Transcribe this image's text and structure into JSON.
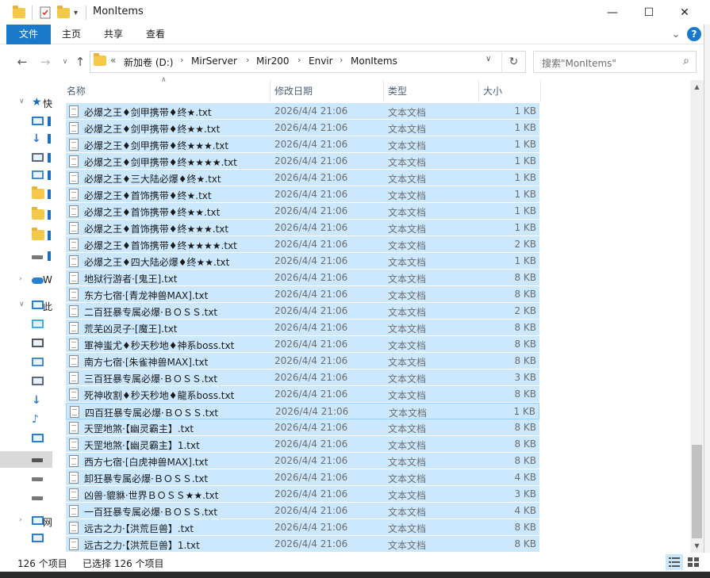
{
  "window": {
    "title": "MonItems",
    "minimize_glyph": "—",
    "maximize_glyph": "☐",
    "close_glyph": "✕"
  },
  "ribbon": {
    "tabs": [
      "文件",
      "主页",
      "共享",
      "查看"
    ],
    "help_glyph": "?",
    "expand_glyph": "⌄"
  },
  "address": {
    "overflow": "«",
    "crumbs": [
      "新加卷 (D:)",
      "MirServer",
      "Mir200",
      "Envir",
      "MonItems"
    ],
    "search_placeholder": "搜索\"MonItems\""
  },
  "navpane": {
    "items": [
      {
        "label": "快",
        "icon": "star-icon"
      },
      {
        "label": "",
        "icon": "desktop-icon"
      },
      {
        "label": "",
        "icon": "download-icon"
      },
      {
        "label": "",
        "icon": "documents-icon"
      },
      {
        "label": "",
        "icon": "pictures-icon"
      },
      {
        "label": "",
        "icon": "folder-icon"
      },
      {
        "label": "",
        "icon": "folder-icon"
      },
      {
        "label": "",
        "icon": "folder-icon"
      },
      {
        "label": "",
        "icon": "drive-icon"
      },
      {
        "label": "W",
        "icon": "cloud-icon"
      },
      {
        "label": "此",
        "icon": "computer-icon"
      },
      {
        "label": "",
        "icon": "3d-objects-icon"
      },
      {
        "label": "",
        "icon": "video-icon"
      },
      {
        "label": "",
        "icon": "pictures-icon"
      },
      {
        "label": "",
        "icon": "documents-icon"
      },
      {
        "label": "",
        "icon": "download-icon"
      },
      {
        "label": "",
        "icon": "music-icon"
      },
      {
        "label": "",
        "icon": "desktop-icon"
      },
      {
        "label": "",
        "icon": "system-drive-icon"
      },
      {
        "label": "",
        "icon": "drive-icon"
      },
      {
        "label": "",
        "icon": "drive-icon"
      },
      {
        "label": "网",
        "icon": "network-icon"
      },
      {
        "label": "",
        "icon": "computer-icon"
      }
    ]
  },
  "columns": {
    "name": "名称",
    "date": "修改日期",
    "type": "类型",
    "size": "大小"
  },
  "files": [
    {
      "name": "必爆之王♦剑甲携带♦终★.txt",
      "date": "2026/4/4 21:06",
      "type": "文本文档",
      "size": "1 KB"
    },
    {
      "name": "必爆之王♦剑甲携带♦终★★.txt",
      "date": "2026/4/4 21:06",
      "type": "文本文档",
      "size": "1 KB"
    },
    {
      "name": "必爆之王♦剑甲携带♦终★★★.txt",
      "date": "2026/4/4 21:06",
      "type": "文本文档",
      "size": "1 KB"
    },
    {
      "name": "必爆之王♦剑甲携带♦终★★★★.txt",
      "date": "2026/4/4 21:06",
      "type": "文本文档",
      "size": "1 KB"
    },
    {
      "name": "必爆之王♦三大陆必爆♦终★.txt",
      "date": "2026/4/4 21:06",
      "type": "文本文档",
      "size": "1 KB"
    },
    {
      "name": "必爆之王♦首饰携带♦终★.txt",
      "date": "2026/4/4 21:06",
      "type": "文本文档",
      "size": "1 KB"
    },
    {
      "name": "必爆之王♦首饰携带♦终★★.txt",
      "date": "2026/4/4 21:06",
      "type": "文本文档",
      "size": "1 KB"
    },
    {
      "name": "必爆之王♦首饰携带♦终★★★.txt",
      "date": "2026/4/4 21:06",
      "type": "文本文档",
      "size": "1 KB"
    },
    {
      "name": "必爆之王♦首饰携带♦终★★★★.txt",
      "date": "2026/4/4 21:06",
      "type": "文本文档",
      "size": "2 KB"
    },
    {
      "name": "必爆之王♦四大陆必爆♦终★★.txt",
      "date": "2026/4/4 21:06",
      "type": "文本文档",
      "size": "1 KB"
    },
    {
      "name": "地狱行游者·[鬼王].txt",
      "date": "2026/4/4 21:06",
      "type": "文本文档",
      "size": "8 KB"
    },
    {
      "name": "东方七宿·[青龙神兽MAX].txt",
      "date": "2026/4/4 21:06",
      "type": "文本文档",
      "size": "8 KB"
    },
    {
      "name": "二百狂暴专属必爆·ＢＯＳＳ.txt",
      "date": "2026/4/4 21:06",
      "type": "文本文档",
      "size": "2 KB"
    },
    {
      "name": "荒芜凶灵子·[魔王].txt",
      "date": "2026/4/4 21:06",
      "type": "文本文档",
      "size": "8 KB"
    },
    {
      "name": "軍神蚩尤♦秒天秒地♦神系boss.txt",
      "date": "2026/4/4 21:06",
      "type": "文本文档",
      "size": "8 KB"
    },
    {
      "name": "南方七宿·[朱雀神兽MAX].txt",
      "date": "2026/4/4 21:06",
      "type": "文本文档",
      "size": "8 KB"
    },
    {
      "name": "三百狂暴专属必爆·ＢＯＳＳ.txt",
      "date": "2026/4/4 21:06",
      "type": "文本文档",
      "size": "3 KB"
    },
    {
      "name": "死神收割♦秒天秒地♦龍系boss.txt",
      "date": "2026/4/4 21:06",
      "type": "文本文档",
      "size": "8 KB"
    },
    {
      "name": "四百狂暴专属必爆·ＢＯＳＳ.txt",
      "date": "2026/4/4 21:06",
      "type": "文本文档",
      "size": "1 KB"
    },
    {
      "name": "天罡地煞·【幽灵霸主】.txt",
      "date": "2026/4/4 21:06",
      "type": "文本文档",
      "size": "8 KB"
    },
    {
      "name": "天罡地煞·【幽灵霸主】1.txt",
      "date": "2026/4/4 21:06",
      "type": "文本文档",
      "size": "8 KB"
    },
    {
      "name": "西方七宿·[白虎神兽MAX].txt",
      "date": "2026/4/4 21:06",
      "type": "文本文档",
      "size": "8 KB"
    },
    {
      "name": "卸狂暴专属必爆·ＢＯＳＳ.txt",
      "date": "2026/4/4 21:06",
      "type": "文本文档",
      "size": "4 KB"
    },
    {
      "name": "凶兽·貔貅·世界ＢＯＳＳ★★.txt",
      "date": "2026/4/4 21:06",
      "type": "文本文档",
      "size": "3 KB"
    },
    {
      "name": "一百狂暴专属必爆·ＢＯＳＳ.txt",
      "date": "2026/4/4 21:06",
      "type": "文本文档",
      "size": "4 KB"
    },
    {
      "name": "远古之力·【洪荒巨兽】.txt",
      "date": "2026/4/4 21:06",
      "type": "文本文档",
      "size": "8 KB"
    },
    {
      "name": "远古之力·【洪荒巨兽】1.txt",
      "date": "2026/4/4 21:06",
      "type": "文本文档",
      "size": "8 KB"
    }
  ],
  "status": {
    "count": "126 个项目",
    "selected": "已选择 126 个项目"
  },
  "colors": {
    "accent": "#1979ca",
    "selection": "#cce8ff",
    "folder": "#f4c84a"
  }
}
